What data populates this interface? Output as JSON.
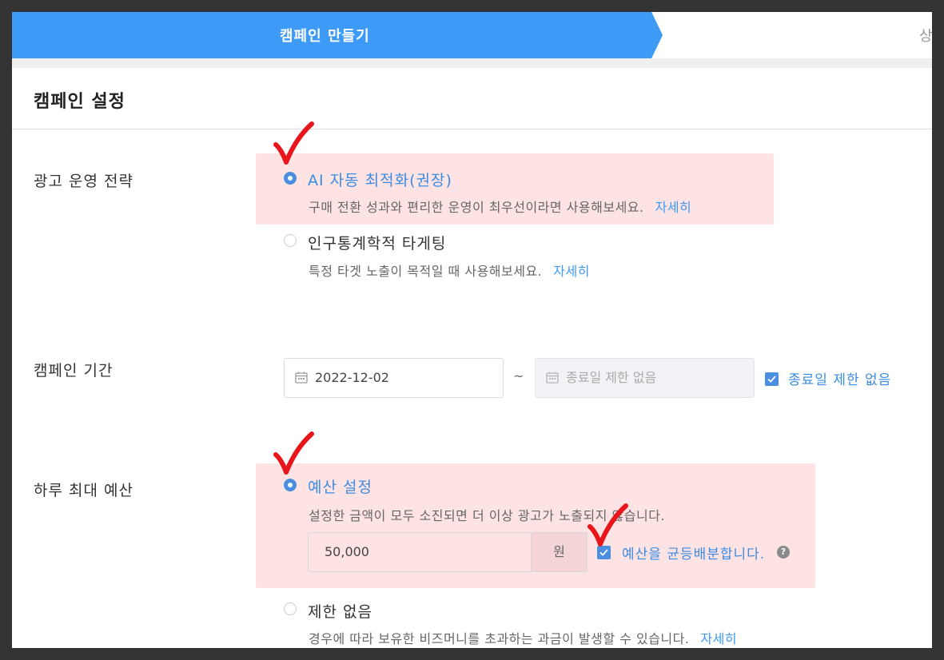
{
  "stepper": {
    "active_step": "캠페인 만들기",
    "next_step": "상"
  },
  "section": {
    "title": "캠페인 설정"
  },
  "strategy": {
    "label": "광고 운영 전략",
    "options": [
      {
        "title": "AI 자동 최적화(권장)",
        "desc": "구매 전환 성과와 편리한 운영이 최우선이라면 사용해보세요.",
        "link": "자세히",
        "selected": true
      },
      {
        "title": "인구통계학적 타게팅",
        "desc": "특정 타겟 노출이 목적일 때 사용해보세요.",
        "link": "자세히",
        "selected": false
      }
    ]
  },
  "period": {
    "label": "캠페인 기간",
    "start_date": "2022-12-02",
    "separator": "~",
    "end_placeholder": "종료일 제한 없음",
    "no_end_checkbox": {
      "label": "종료일 제한 없음",
      "checked": true
    }
  },
  "budget": {
    "label": "하루 최대 예산",
    "options": [
      {
        "title": "예산 설정",
        "desc": "설정한 금액이 모두 소진되면 더 이상 광고가 노출되지 않습니다.",
        "selected": true
      },
      {
        "title": "제한 없음",
        "desc": "경우에 따라 보유한 비즈머니를 초과하는 과금이 발생할 수 있습니다.",
        "link": "자세히",
        "selected": false
      }
    ],
    "amount": "50,000",
    "unit": "원",
    "even_split": {
      "label": "예산을 균등배분합니다.",
      "checked": true
    },
    "help_glyph": "?"
  },
  "colors": {
    "accent": "#3d9bf7",
    "highlight": "#fde3e3",
    "annotation_check": "#e8151b"
  },
  "icons": [
    "calendar-icon",
    "checkbox-check-icon",
    "help-icon",
    "red-check-annotation"
  ]
}
